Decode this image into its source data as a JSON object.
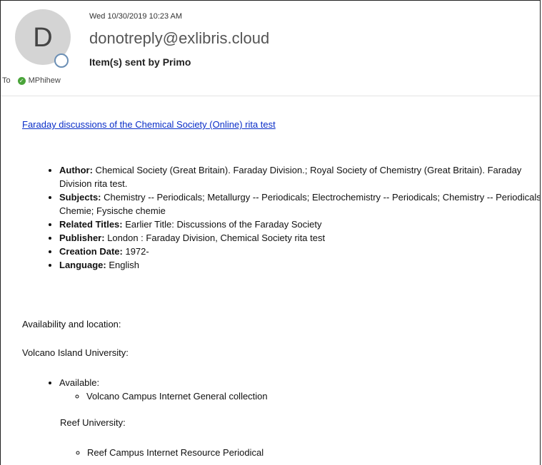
{
  "header": {
    "date": "Wed 10/30/2019 10:23 AM",
    "avatar_letter": "D",
    "sender": "donotreply@exlibris.cloud",
    "subject": "Item(s) sent by Primo",
    "to_label": "To",
    "recipient": "MPhihew"
  },
  "body": {
    "title_link": "Faraday discussions of the Chemical Society (Online) rita test",
    "details": [
      {
        "label": "Author:",
        "value": " Chemical Society (Great Britain). Faraday Division.; Royal Society of Chemistry (Great Britain). Faraday Division rita test."
      },
      {
        "label": "Subjects:",
        "value": " Chemistry -- Periodicals; Metallurgy -- Periodicals; Electrochemistry -- Periodicals; Chemistry -- Periodicals; Chemie; Fysische chemie"
      },
      {
        "label": "Related Titles:",
        "value": " Earlier Title: Discussions of the Faraday Society"
      },
      {
        "label": "Publisher:",
        "value": " London : Faraday Division, Chemical Society rita test"
      },
      {
        "label": "Creation Date:",
        "value": " 1972-"
      },
      {
        "label": "Language:",
        "value": " English"
      }
    ],
    "availability_heading": "Availability and location:",
    "org1": "Volcano Island University:",
    "status": "Available:",
    "location1": "Volcano Campus Internet General collection",
    "org2": "Reef University:",
    "location2": "Reef Campus Internet Resource Periodical"
  }
}
